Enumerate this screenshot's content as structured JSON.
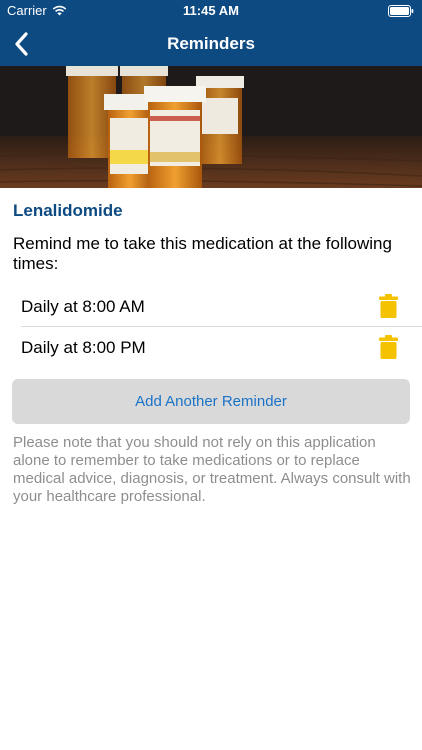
{
  "status_bar": {
    "carrier": "Carrier",
    "time": "11:45 AM",
    "wifi_icon": "wifi-icon",
    "battery_icon": "battery-icon"
  },
  "nav": {
    "title": "Reminders",
    "back_icon": "chevron-left-icon"
  },
  "medication": {
    "name": "Lenalidomide"
  },
  "prompt": "Remind me to take this medication at the following times:",
  "reminders": [
    {
      "label": "Daily at 8:00 AM",
      "icon": "trash-icon"
    },
    {
      "label": "Daily at 8:00 PM",
      "icon": "trash-icon"
    }
  ],
  "add_button": "Add Another Reminder",
  "disclaimer": "Please note that you should not rely on this application alone to remember to take medications or to replace medical advice, diagnosis, or treatment. Always consult with your healthcare professional.",
  "colors": {
    "nav_bar": "#0d4a82",
    "med_name": "#0d4a82",
    "trash": "#f5c200",
    "button_bg": "#d9d9d9",
    "button_text": "#1a73c9",
    "disclaimer": "#8e8e8e"
  }
}
